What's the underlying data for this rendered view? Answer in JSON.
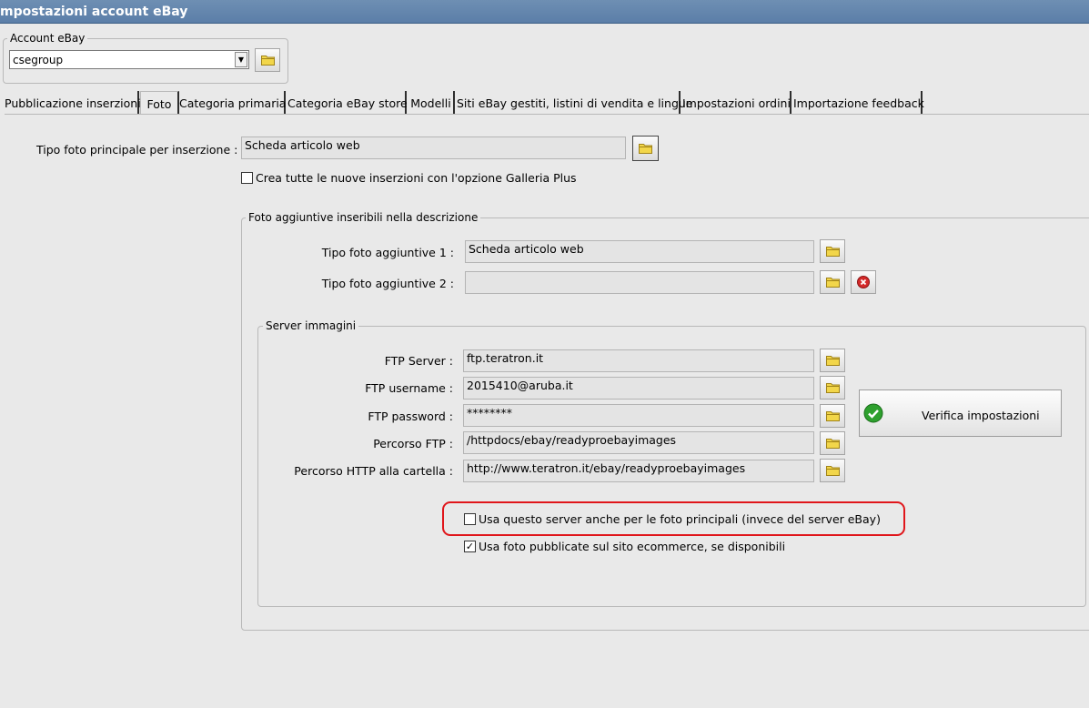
{
  "window": {
    "title": "mpostazioni account eBay"
  },
  "account": {
    "group_label": "Account eBay",
    "selected": "csegroup"
  },
  "tabs": [
    {
      "label": "Pubblicazione inserzioni"
    },
    {
      "label": "Foto"
    },
    {
      "label": "Categoria primaria"
    },
    {
      "label": "Categoria eBay store"
    },
    {
      "label": "Modelli"
    },
    {
      "label": "Siti eBay gestiti, listini di vendita e lingue"
    },
    {
      "label": "Impostazioni ordini"
    },
    {
      "label": "Importazione feedback"
    }
  ],
  "active_tab": "Foto",
  "foto": {
    "main_type_label": "Tipo foto principale per inserzione :",
    "main_type_value": "Scheda articolo web",
    "galleria_plus_label": "Crea tutte le nuove inserzioni con l'opzione Galleria Plus",
    "galleria_plus_checked": false,
    "additional": {
      "group_label": "Foto aggiuntive inseribili nella descrizione",
      "type1_label": "Tipo foto aggiuntive 1 :",
      "type1_value": "Scheda articolo web",
      "type2_label": "Tipo foto aggiuntive 2 :",
      "type2_value": ""
    },
    "server": {
      "group_label": "Server immagini",
      "ftp_server_label": "FTP Server :",
      "ftp_server_value": "ftp.teratron.it",
      "ftp_username_label": "FTP username :",
      "ftp_username_value": "2015410@aruba.it",
      "ftp_password_label": "FTP password :",
      "ftp_password_value": "********",
      "ftp_path_label": "Percorso FTP :",
      "ftp_path_value": "/httpdocs/ebay/readyproebayimages",
      "http_path_label": "Percorso HTTP alla cartella :",
      "http_path_value": "http://www.teratron.it/ebay/readyproebayimages",
      "verify_label": "Verifica impostazioni",
      "use_server_label": "Usa questo server anche per le foto principali (invece del server eBay)",
      "use_server_checked": false,
      "use_ecommerce_label": "Usa foto pubblicate sul sito ecommerce, se disponibili",
      "use_ecommerce_checked": true
    }
  },
  "colors": {
    "title_bar": "#5b7ea8",
    "highlight": "#e0161b",
    "ok_icon": "#2ea02e",
    "delete_icon": "#d42a2a"
  },
  "icons": [
    "folder-icon",
    "delete-icon",
    "check-ok-icon",
    "chevron-down-icon"
  ]
}
